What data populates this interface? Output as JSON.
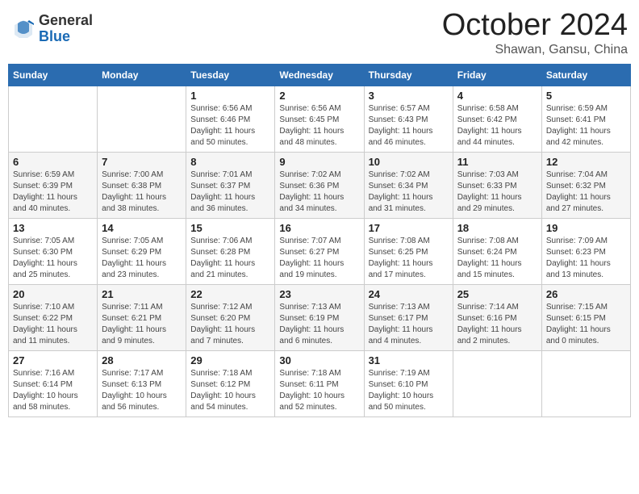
{
  "header": {
    "logo_general": "General",
    "logo_blue": "Blue",
    "month_title": "October 2024",
    "location": "Shawan, Gansu, China"
  },
  "weekdays": [
    "Sunday",
    "Monday",
    "Tuesday",
    "Wednesday",
    "Thursday",
    "Friday",
    "Saturday"
  ],
  "weeks": [
    [
      {
        "day": "",
        "info": ""
      },
      {
        "day": "",
        "info": ""
      },
      {
        "day": "1",
        "info": "Sunrise: 6:56 AM\nSunset: 6:46 PM\nDaylight: 11 hours and 50 minutes."
      },
      {
        "day": "2",
        "info": "Sunrise: 6:56 AM\nSunset: 6:45 PM\nDaylight: 11 hours and 48 minutes."
      },
      {
        "day": "3",
        "info": "Sunrise: 6:57 AM\nSunset: 6:43 PM\nDaylight: 11 hours and 46 minutes."
      },
      {
        "day": "4",
        "info": "Sunrise: 6:58 AM\nSunset: 6:42 PM\nDaylight: 11 hours and 44 minutes."
      },
      {
        "day": "5",
        "info": "Sunrise: 6:59 AM\nSunset: 6:41 PM\nDaylight: 11 hours and 42 minutes."
      }
    ],
    [
      {
        "day": "6",
        "info": "Sunrise: 6:59 AM\nSunset: 6:39 PM\nDaylight: 11 hours and 40 minutes."
      },
      {
        "day": "7",
        "info": "Sunrise: 7:00 AM\nSunset: 6:38 PM\nDaylight: 11 hours and 38 minutes."
      },
      {
        "day": "8",
        "info": "Sunrise: 7:01 AM\nSunset: 6:37 PM\nDaylight: 11 hours and 36 minutes."
      },
      {
        "day": "9",
        "info": "Sunrise: 7:02 AM\nSunset: 6:36 PM\nDaylight: 11 hours and 34 minutes."
      },
      {
        "day": "10",
        "info": "Sunrise: 7:02 AM\nSunset: 6:34 PM\nDaylight: 11 hours and 31 minutes."
      },
      {
        "day": "11",
        "info": "Sunrise: 7:03 AM\nSunset: 6:33 PM\nDaylight: 11 hours and 29 minutes."
      },
      {
        "day": "12",
        "info": "Sunrise: 7:04 AM\nSunset: 6:32 PM\nDaylight: 11 hours and 27 minutes."
      }
    ],
    [
      {
        "day": "13",
        "info": "Sunrise: 7:05 AM\nSunset: 6:30 PM\nDaylight: 11 hours and 25 minutes."
      },
      {
        "day": "14",
        "info": "Sunrise: 7:05 AM\nSunset: 6:29 PM\nDaylight: 11 hours and 23 minutes."
      },
      {
        "day": "15",
        "info": "Sunrise: 7:06 AM\nSunset: 6:28 PM\nDaylight: 11 hours and 21 minutes."
      },
      {
        "day": "16",
        "info": "Sunrise: 7:07 AM\nSunset: 6:27 PM\nDaylight: 11 hours and 19 minutes."
      },
      {
        "day": "17",
        "info": "Sunrise: 7:08 AM\nSunset: 6:25 PM\nDaylight: 11 hours and 17 minutes."
      },
      {
        "day": "18",
        "info": "Sunrise: 7:08 AM\nSunset: 6:24 PM\nDaylight: 11 hours and 15 minutes."
      },
      {
        "day": "19",
        "info": "Sunrise: 7:09 AM\nSunset: 6:23 PM\nDaylight: 11 hours and 13 minutes."
      }
    ],
    [
      {
        "day": "20",
        "info": "Sunrise: 7:10 AM\nSunset: 6:22 PM\nDaylight: 11 hours and 11 minutes."
      },
      {
        "day": "21",
        "info": "Sunrise: 7:11 AM\nSunset: 6:21 PM\nDaylight: 11 hours and 9 minutes."
      },
      {
        "day": "22",
        "info": "Sunrise: 7:12 AM\nSunset: 6:20 PM\nDaylight: 11 hours and 7 minutes."
      },
      {
        "day": "23",
        "info": "Sunrise: 7:13 AM\nSunset: 6:19 PM\nDaylight: 11 hours and 6 minutes."
      },
      {
        "day": "24",
        "info": "Sunrise: 7:13 AM\nSunset: 6:17 PM\nDaylight: 11 hours and 4 minutes."
      },
      {
        "day": "25",
        "info": "Sunrise: 7:14 AM\nSunset: 6:16 PM\nDaylight: 11 hours and 2 minutes."
      },
      {
        "day": "26",
        "info": "Sunrise: 7:15 AM\nSunset: 6:15 PM\nDaylight: 11 hours and 0 minutes."
      }
    ],
    [
      {
        "day": "27",
        "info": "Sunrise: 7:16 AM\nSunset: 6:14 PM\nDaylight: 10 hours and 58 minutes."
      },
      {
        "day": "28",
        "info": "Sunrise: 7:17 AM\nSunset: 6:13 PM\nDaylight: 10 hours and 56 minutes."
      },
      {
        "day": "29",
        "info": "Sunrise: 7:18 AM\nSunset: 6:12 PM\nDaylight: 10 hours and 54 minutes."
      },
      {
        "day": "30",
        "info": "Sunrise: 7:18 AM\nSunset: 6:11 PM\nDaylight: 10 hours and 52 minutes."
      },
      {
        "day": "31",
        "info": "Sunrise: 7:19 AM\nSunset: 6:10 PM\nDaylight: 10 hours and 50 minutes."
      },
      {
        "day": "",
        "info": ""
      },
      {
        "day": "",
        "info": ""
      }
    ]
  ]
}
